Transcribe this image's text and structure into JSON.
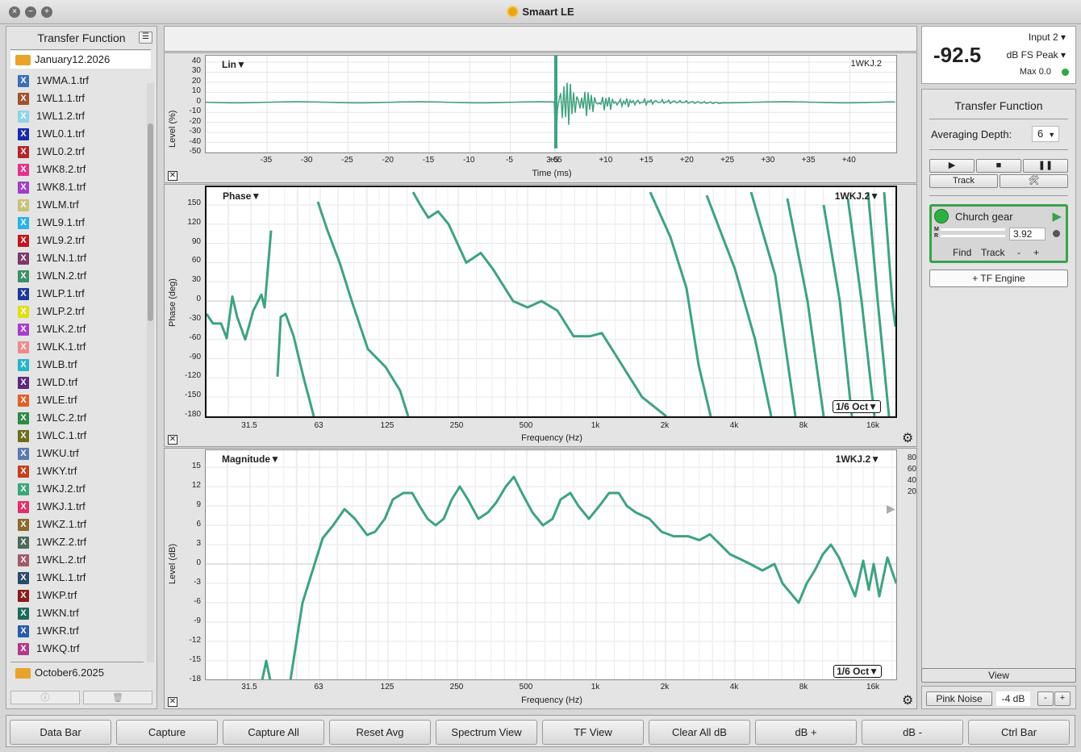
{
  "app": {
    "title": "Smaart LE"
  },
  "window_controls": {
    "close": "×",
    "minimize": "−",
    "zoom": "+"
  },
  "sidebar": {
    "title": "Transfer Function",
    "folder_open": "January12.2026",
    "folder_closed": "October6.2025",
    "files": [
      {
        "name": "1WMA.1.trf",
        "color": "#3b6fb6"
      },
      {
        "name": "1WL1.1.trf",
        "color": "#a0522d"
      },
      {
        "name": "1WL1.2.trf",
        "color": "#8fd3e8"
      },
      {
        "name": "1WL0.1.trf",
        "color": "#1a2aa8"
      },
      {
        "name": "1WL0.2.trf",
        "color": "#b3262b"
      },
      {
        "name": "1WK8.2.trf",
        "color": "#e0358c"
      },
      {
        "name": "1WK8.1.trf",
        "color": "#a040c8"
      },
      {
        "name": "1WLM.trf",
        "color": "#c8c27a"
      },
      {
        "name": "1WL9.1.trf",
        "color": "#2ab2e8"
      },
      {
        "name": "1WL9.2.trf",
        "color": "#c2161f"
      },
      {
        "name": "1WLN.1.trf",
        "color": "#7a3b6a"
      },
      {
        "name": "1WLN.2.trf",
        "color": "#3e8f6a"
      },
      {
        "name": "1WLP.1.trf",
        "color": "#1c3a9a"
      },
      {
        "name": "1WLP.2.trf",
        "color": "#dede1c"
      },
      {
        "name": "1WLK.2.trf",
        "color": "#a83fcc"
      },
      {
        "name": "1WLK.1.trf",
        "color": "#f08a8a"
      },
      {
        "name": "1WLB.trf",
        "color": "#27b5c9"
      },
      {
        "name": "1WLD.trf",
        "color": "#5a2a7a"
      },
      {
        "name": "1WLE.trf",
        "color": "#e0602a"
      },
      {
        "name": "1WLC.2.trf",
        "color": "#2e8b4a"
      },
      {
        "name": "1WLC.1.trf",
        "color": "#6d6d1e"
      },
      {
        "name": "1WKU.trf",
        "color": "#5a7ab0"
      },
      {
        "name": "1WKY.trf",
        "color": "#c0421e"
      },
      {
        "name": "1WKJ.2.trf",
        "color": "#3aa679"
      },
      {
        "name": "1WKJ.1.trf",
        "color": "#e0306e"
      },
      {
        "name": "1WKZ.1.trf",
        "color": "#8a6a2a"
      },
      {
        "name": "1WKZ.2.trf",
        "color": "#4a6a5a"
      },
      {
        "name": "1WKL.2.trf",
        "color": "#a05a6a"
      },
      {
        "name": "1WKL.1.trf",
        "color": "#2a4a6a"
      },
      {
        "name": "1WKP.trf",
        "color": "#8a1c1c"
      },
      {
        "name": "1WKN.trf",
        "color": "#1c6a5a"
      },
      {
        "name": "1WKR.trf",
        "color": "#2a5aa8"
      },
      {
        "name": "1WKQ.trf",
        "color": "#b03a8a"
      }
    ]
  },
  "impulse": {
    "title": "Lin▼",
    "trace": "1WKJ.2",
    "ylabel": "Level (%)",
    "xlabel": "Time (ms)",
    "yticks": [
      "40",
      "30",
      "20",
      "10",
      "0",
      "-10",
      "-20",
      "-30",
      "-40",
      "-50"
    ],
    "xticks": [
      "-35",
      "-30",
      "-25",
      "-20",
      "-15",
      "-10",
      "-5",
      "3.65",
      "+5",
      "+10",
      "+15",
      "+20",
      "+25",
      "+30",
      "+35",
      "+40"
    ]
  },
  "phase": {
    "title": "Phase▼",
    "trace": "1WKJ.2▼",
    "smoothing": "1/6 Oct▼",
    "ylabel": "Phase (deg)",
    "xlabel": "Frequency (Hz)",
    "yticks": [
      "150",
      "120",
      "90",
      "60",
      "30",
      "0",
      "-30",
      "-60",
      "-90",
      "-120",
      "-150",
      "-180"
    ],
    "xticks": [
      "31.5",
      "63",
      "125",
      "250",
      "500",
      "1k",
      "2k",
      "4k",
      "8k",
      "16k"
    ]
  },
  "magnitude": {
    "title": "Magnitude▼",
    "trace": "1WKJ.2▼",
    "smoothing": "1/6 Oct▼",
    "ylabel": "Level (dB)",
    "xlabel": "Frequency (Hz)",
    "yticks": [
      "15",
      "12",
      "9",
      "6",
      "3",
      "0",
      "-3",
      "-6",
      "-9",
      "-12",
      "-15",
      "-18"
    ],
    "xticks": [
      "31.5",
      "63",
      "125",
      "250",
      "500",
      "1k",
      "2k",
      "4k",
      "8k",
      "16k"
    ],
    "coherence_ticks": [
      "80",
      "60",
      "40",
      "20"
    ]
  },
  "meter": {
    "value": "-92.5",
    "input": "Input 2",
    "mode": "dB FS Peak",
    "max": "Max 0.0"
  },
  "tf_panel": {
    "title": "Transfer Function",
    "averaging_label": "Averaging Depth:",
    "averaging_value": "6",
    "track_label": "Track",
    "engine": {
      "name": "Church gear",
      "delay": "3.92",
      "find": "Find",
      "track": "Track",
      "minus": "-",
      "plus": "+",
      "m": "M",
      "r": "R"
    },
    "add_engine": "+ TF Engine",
    "view": "View",
    "generator": "Pink Noise",
    "gen_level": "-4 dB",
    "gen_minus": "-",
    "gen_plus": "+"
  },
  "bottom_buttons": [
    "Data Bar",
    "Capture",
    "Capture All",
    "Reset Avg",
    "Spectrum View",
    "TF View",
    "Clear All dB",
    "dB +",
    "dB -",
    "Ctrl Bar"
  ],
  "colors": {
    "trace": "#3ea37e",
    "accent_green": "#39a24b",
    "folder": "#e8a32b"
  }
}
